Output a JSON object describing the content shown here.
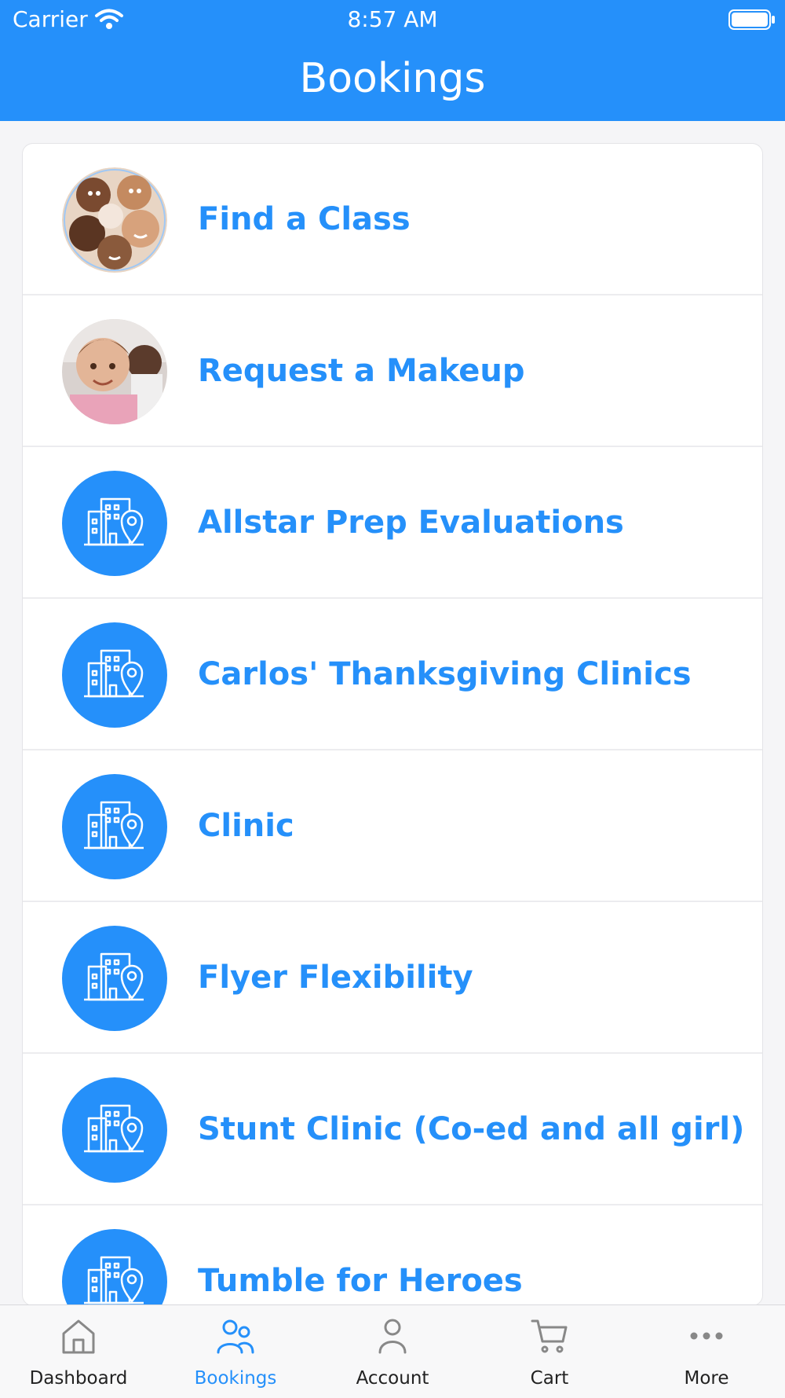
{
  "status_bar": {
    "carrier": "Carrier",
    "time": "8:57 AM"
  },
  "header": {
    "title": "Bookings"
  },
  "colors": {
    "accent": "#2590fa",
    "header_bg": "#2590fa",
    "background": "#f5f5f7",
    "tab_inactive": "#888888"
  },
  "list": {
    "items": [
      {
        "label": "Find a Class",
        "thumb": "kids-huddle-photo"
      },
      {
        "label": "Request a Makeup",
        "thumb": "kids-classroom-photo"
      },
      {
        "label": "Allstar Prep Evaluations",
        "thumb": "building-location-icon"
      },
      {
        "label": "Carlos' Thanksgiving Clinics",
        "thumb": "building-location-icon"
      },
      {
        "label": "Clinic",
        "thumb": "building-location-icon"
      },
      {
        "label": "Flyer Flexibility",
        "thumb": "building-location-icon"
      },
      {
        "label": "Stunt Clinic (Co-ed and all girl)",
        "thumb": "building-location-icon"
      },
      {
        "label": "Tumble for Heroes",
        "thumb": "building-location-icon"
      }
    ]
  },
  "tabbar": {
    "tabs": [
      {
        "label": "Dashboard",
        "icon": "house-icon",
        "active": false
      },
      {
        "label": "Bookings",
        "icon": "people-icon",
        "active": true
      },
      {
        "label": "Account",
        "icon": "person-icon",
        "active": false
      },
      {
        "label": "Cart",
        "icon": "cart-icon",
        "active": false
      },
      {
        "label": "More",
        "icon": "ellipsis-icon",
        "active": false
      }
    ]
  }
}
